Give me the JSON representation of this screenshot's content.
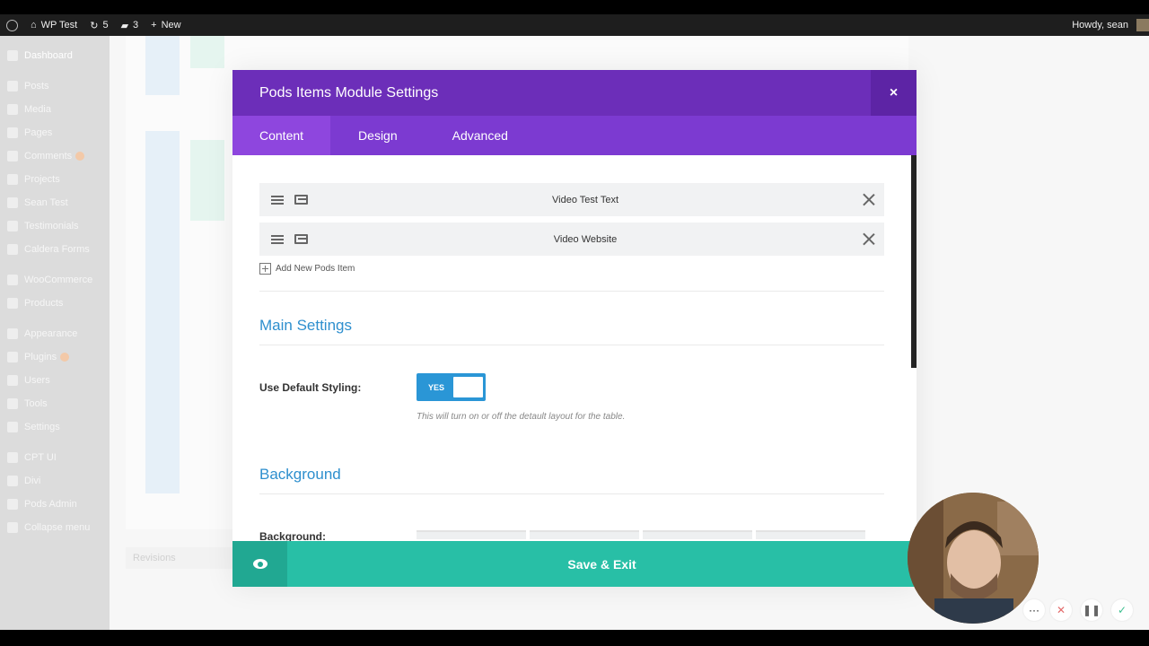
{
  "admin_bar": {
    "site_name": "WP Test",
    "updates_count": "5",
    "comments_count": "3",
    "new_label": "New",
    "greeting": "Howdy, sean"
  },
  "sidebar": {
    "items": [
      {
        "label": "Dashboard"
      },
      {
        "label": "Posts"
      },
      {
        "label": "Media"
      },
      {
        "label": "Pages"
      },
      {
        "label": "Comments"
      },
      {
        "label": "Projects"
      },
      {
        "label": "Sean Test"
      },
      {
        "label": "Testimonials"
      },
      {
        "label": "Caldera Forms"
      },
      {
        "label": "WooCommerce"
      },
      {
        "label": "Products"
      },
      {
        "label": "Appearance"
      },
      {
        "label": "Plugins"
      },
      {
        "label": "Users"
      },
      {
        "label": "Tools"
      },
      {
        "label": "Settings"
      },
      {
        "label": "CPT UI"
      },
      {
        "label": "Divi"
      },
      {
        "label": "Pods Admin"
      },
      {
        "label": "Collapse menu"
      }
    ]
  },
  "background_page": {
    "revisions_label": "Revisions"
  },
  "modal": {
    "title": "Pods Items Module Settings",
    "close_symbol": "×",
    "tabs": [
      {
        "label": "Content"
      },
      {
        "label": "Design"
      },
      {
        "label": "Advanced"
      }
    ],
    "items": [
      {
        "label": "Video Test Text"
      },
      {
        "label": "Video Website"
      }
    ],
    "add_item_label": "Add New Pods Item",
    "main_settings_title": "Main Settings",
    "default_styling_label": "Use Default Styling:",
    "toggle_label": "YES",
    "default_styling_help": "This will turn on or off the detault layout for the table.",
    "background_title": "Background",
    "background_label": "Background:",
    "save_label": "Save & Exit"
  },
  "colors": {
    "header_purple": "#6c2eb9",
    "tab_purple": "#7c3ad1",
    "save_teal": "#28bfa6",
    "toggle_blue": "#2a96d6",
    "section_blue": "#2e8fce"
  }
}
